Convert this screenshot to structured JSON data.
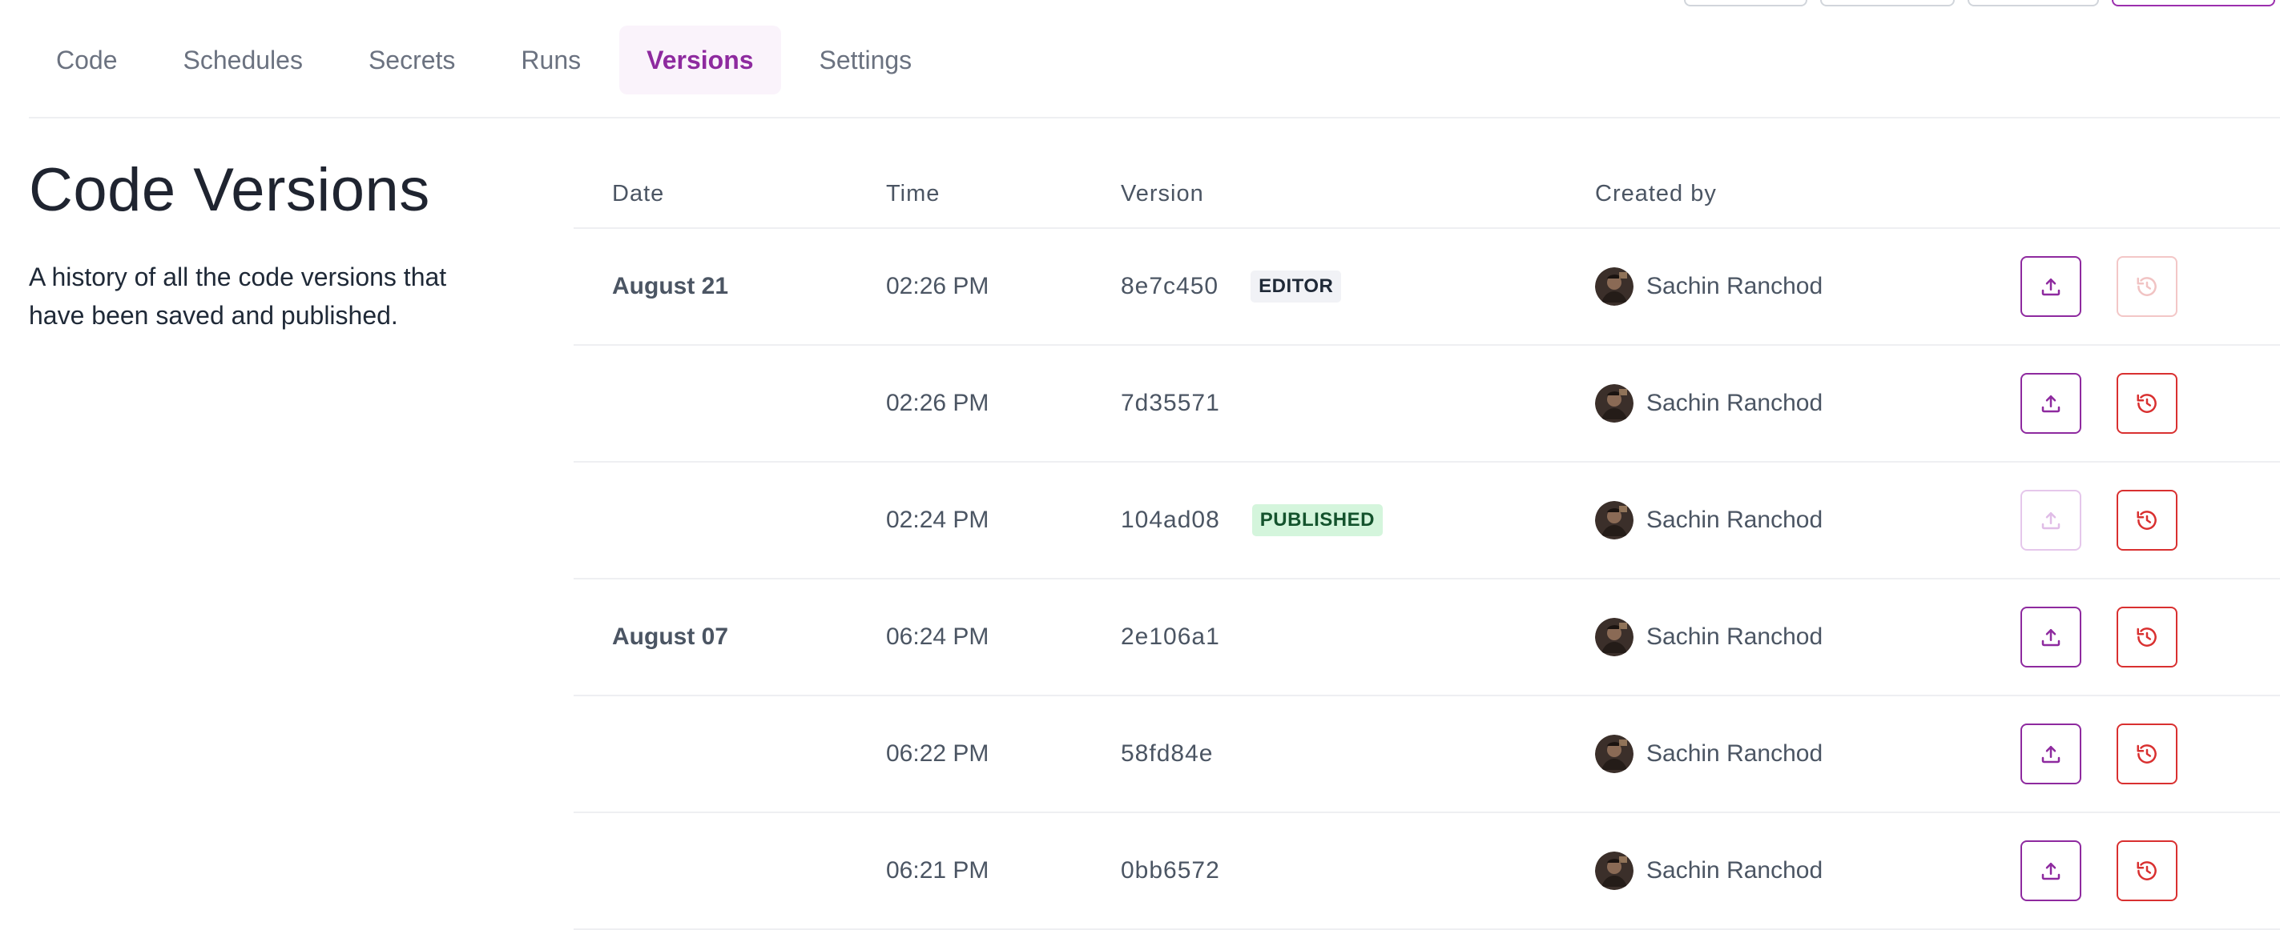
{
  "tabs": [
    {
      "label": "Code",
      "active": false
    },
    {
      "label": "Schedules",
      "active": false
    },
    {
      "label": "Secrets",
      "active": false
    },
    {
      "label": "Runs",
      "active": false
    },
    {
      "label": "Versions",
      "active": true
    },
    {
      "label": "Settings",
      "active": false
    }
  ],
  "intro": {
    "title": "Code Versions",
    "description": "A history of all the code versions that have been saved and published."
  },
  "table": {
    "headers": {
      "date": "Date",
      "time": "Time",
      "version": "Version",
      "created_by": "Created by"
    },
    "rows": [
      {
        "date": "August 21",
        "time": "02:26 PM",
        "version": "8e7c450",
        "badge": "EDITOR",
        "user": "Sachin Ranchod",
        "publish_enabled": true,
        "restore_enabled": false
      },
      {
        "date": "",
        "time": "02:26 PM",
        "version": "7d35571",
        "badge": "",
        "user": "Sachin Ranchod",
        "publish_enabled": true,
        "restore_enabled": true
      },
      {
        "date": "",
        "time": "02:24 PM",
        "version": "104ad08",
        "badge": "PUBLISHED",
        "user": "Sachin Ranchod",
        "publish_enabled": false,
        "restore_enabled": true
      },
      {
        "date": "August 07",
        "time": "06:24 PM",
        "version": "2e106a1",
        "badge": "",
        "user": "Sachin Ranchod",
        "publish_enabled": true,
        "restore_enabled": true
      },
      {
        "date": "",
        "time": "06:22 PM",
        "version": "58fd84e",
        "badge": "",
        "user": "Sachin Ranchod",
        "publish_enabled": true,
        "restore_enabled": true
      },
      {
        "date": "",
        "time": "06:21 PM",
        "version": "0bb6572",
        "badge": "",
        "user": "Sachin Ranchod",
        "publish_enabled": true,
        "restore_enabled": true
      }
    ]
  },
  "icons": {
    "publish": "upload-icon",
    "restore": "history-icon"
  },
  "colors": {
    "accent": "#8e2a9f",
    "danger": "#d93030",
    "published_badge_bg": "#d4f5dc",
    "editor_badge_bg": "#f1f2f6"
  }
}
